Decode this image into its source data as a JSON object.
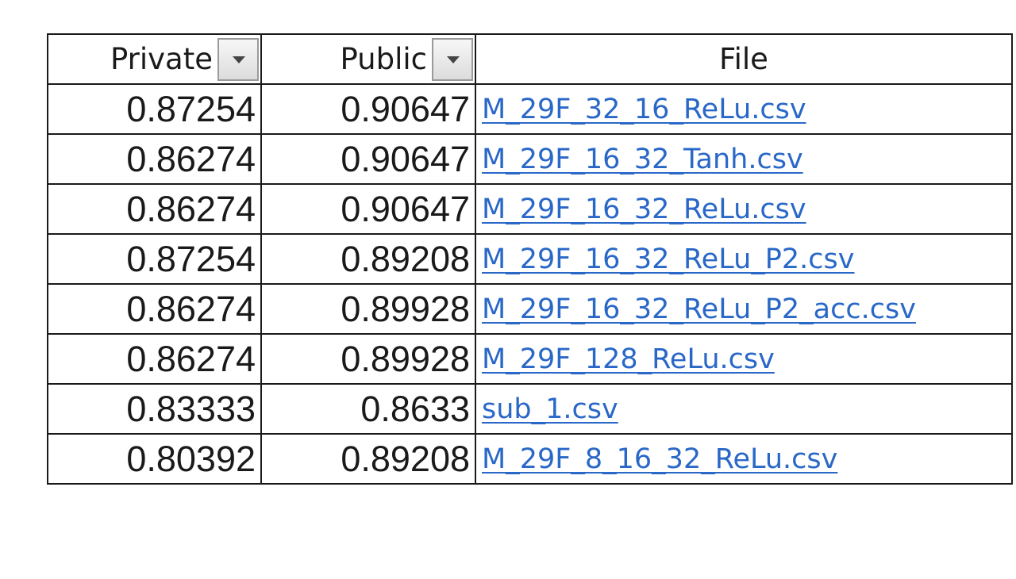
{
  "header": {
    "private_label": "Private",
    "public_label": "Public",
    "file_label": "File"
  },
  "rows": [
    {
      "private": "0.87254",
      "public": "0.90647",
      "file": "M_29F_32_16_ReLu.csv"
    },
    {
      "private": "0.86274",
      "public": "0.90647",
      "file": "M_29F_16_32_Tanh.csv"
    },
    {
      "private": "0.86274",
      "public": "0.90647",
      "file": "M_29F_16_32_ReLu.csv"
    },
    {
      "private": "0.87254",
      "public": "0.89208",
      "file": "M_29F_16_32_ReLu_P2.csv"
    },
    {
      "private": "0.86274",
      "public": "0.89928",
      "file": "M_29F_16_32_ReLu_P2_acc.csv"
    },
    {
      "private": "0.86274",
      "public": "0.89928",
      "file": "M_29F_128_ReLu.csv"
    },
    {
      "private": "0.83333",
      "public": "0.8633",
      "file": "sub_1.csv"
    },
    {
      "private": "0.80392",
      "public": "0.89208",
      "file": "M_29F_8_16_32_ReLu.csv"
    }
  ],
  "icons": {
    "filter": "dropdown-arrow-icon"
  },
  "colors": {
    "link": "#2a68c8",
    "grid": "#1a1a1a"
  }
}
